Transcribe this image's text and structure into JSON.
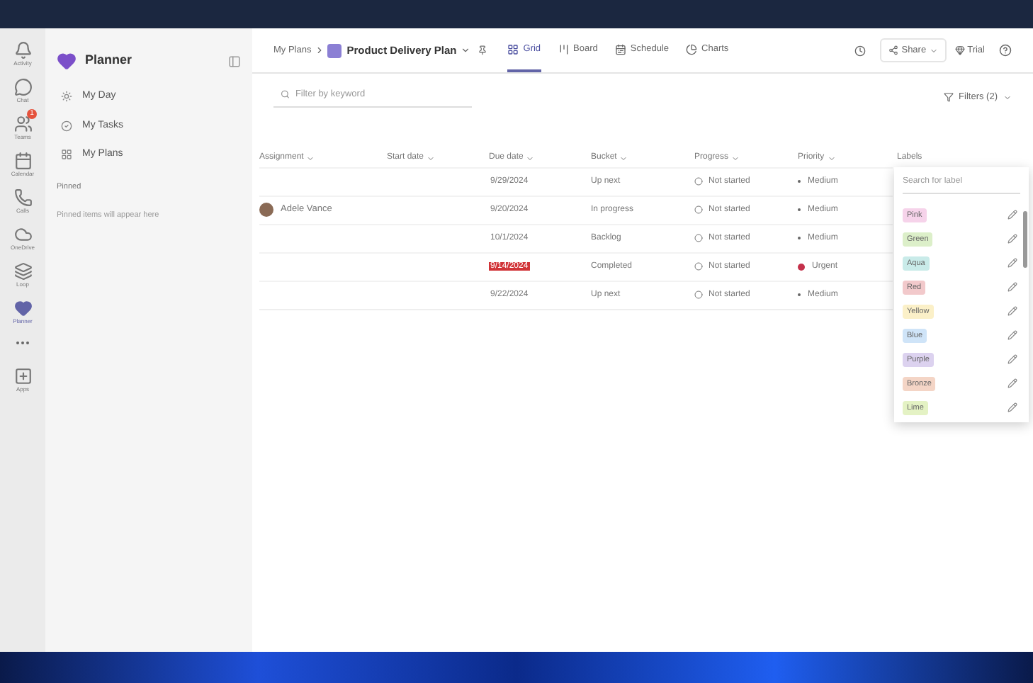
{
  "rail": [
    {
      "label": "Activity",
      "selected": false
    },
    {
      "label": "Chat",
      "selected": false
    },
    {
      "label": "Teams",
      "badge": "1",
      "selected": false
    },
    {
      "label": "Calendar",
      "selected": false
    },
    {
      "label": "Calls",
      "selected": false
    },
    {
      "label": "OneDrive",
      "selected": false
    },
    {
      "label": "Loop",
      "selected": false
    },
    {
      "label": "Planner",
      "selected": true
    },
    {
      "label": "Apps",
      "selected": false
    }
  ],
  "sidebar": {
    "title": "Planner",
    "items": [
      {
        "label": "My Day"
      },
      {
        "label": "My Tasks"
      },
      {
        "label": "My Plans"
      }
    ],
    "pinned_heading": "Pinned",
    "pinned_empty": "Pinned items will appear here"
  },
  "breadcrumb": {
    "parent": "My Plans",
    "plan": "Product Delivery Plan"
  },
  "views": [
    {
      "label": "Grid",
      "selected": true
    },
    {
      "label": "Board",
      "selected": false
    },
    {
      "label": "Schedule",
      "selected": false
    },
    {
      "label": "Charts",
      "selected": false
    }
  ],
  "share_button": "Share",
  "trial_button": "Trial",
  "filter": {
    "placeholder": "Filter by keyword"
  },
  "filters_button": "Filters (2)",
  "table": {
    "columns": [
      "Assignment",
      "Start date",
      "Due date",
      "Bucket",
      "Progress",
      "Priority",
      "Labels"
    ],
    "rows": [
      {
        "due": "9/29/2024",
        "overdue": false,
        "bucket": "Up next",
        "progress": "Not started",
        "priority": "Medium",
        "kind": "medium"
      },
      {
        "assignee": "Adele Vance",
        "due": "9/20/2024",
        "overdue": false,
        "bucket": "In progress",
        "progress": "Not started",
        "priority": "Medium",
        "kind": "medium"
      },
      {
        "due": "10/1/2024",
        "overdue": false,
        "bucket": "Backlog",
        "progress": "Not started",
        "priority": "Medium",
        "kind": "medium"
      },
      {
        "due": "9/14/2024",
        "overdue": true,
        "bucket": "Completed",
        "progress": "Not started",
        "priority": "Urgent",
        "kind": "urgent"
      },
      {
        "due": "9/22/2024",
        "overdue": false,
        "bucket": "Up next",
        "progress": "Not started",
        "priority": "Medium",
        "kind": "medium"
      }
    ]
  },
  "label_picker": {
    "placeholder": "Search for label",
    "labels": [
      {
        "name": "Pink",
        "color": "#f6d3ea"
      },
      {
        "name": "Green",
        "color": "#dcefc9"
      },
      {
        "name": "Aqua",
        "color": "#c9ebe9"
      },
      {
        "name": "Red",
        "color": "#f2c9cb"
      },
      {
        "name": "Yellow",
        "color": "#fbf0c8"
      },
      {
        "name": "Blue",
        "color": "#cfe4f8"
      },
      {
        "name": "Purple",
        "color": "#dcd2ef"
      },
      {
        "name": "Bronze",
        "color": "#f4d5c6"
      },
      {
        "name": "Lime",
        "color": "#e4f2c4"
      }
    ]
  }
}
